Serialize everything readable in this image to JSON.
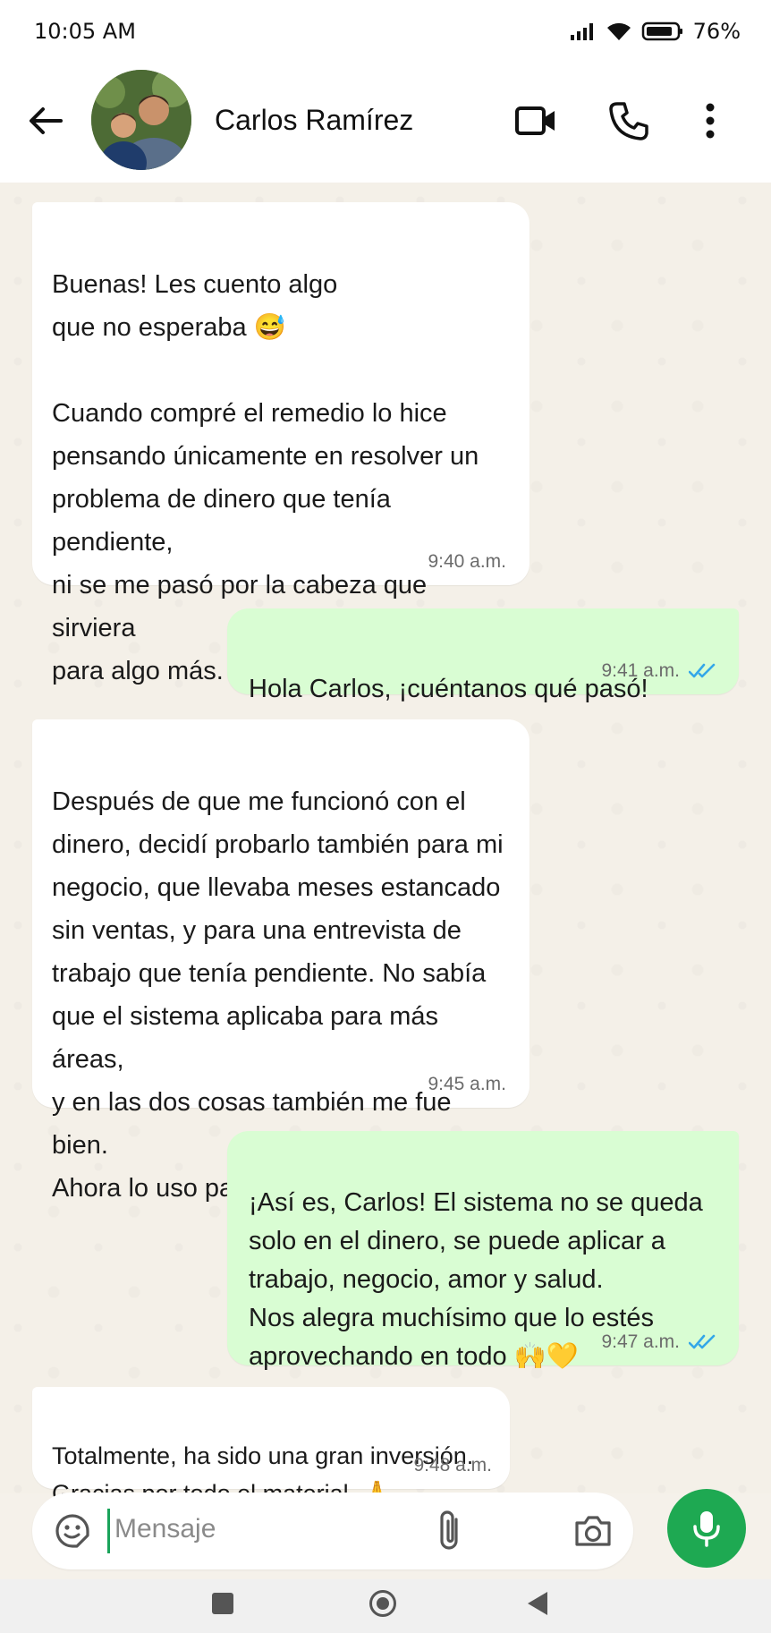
{
  "status_bar": {
    "time": "10:05 AM",
    "battery": "76%"
  },
  "header": {
    "contact_name": "Carlos Ramírez"
  },
  "messages": [
    {
      "direction": "in",
      "text": "Buenas! Les cuento algo\nque no esperaba 😅\n\nCuando compré el remedio lo hice\npensando únicamente en resolver un\nproblema de dinero que tenía pendiente,\nni se me pasó por la cabeza que sirviera\npara algo más.",
      "time": "9:40 a.m."
    },
    {
      "direction": "out",
      "text": "Hola Carlos, ¡cuéntanos qué pasó!",
      "time": "9:41 a.m.",
      "status": "read"
    },
    {
      "direction": "in",
      "text": "Después de que me funcionó con el\ndinero, decidí probarlo también para mi\nnegocio, que llevaba meses estancado\nsin ventas, y para una entrevista de\ntrabajo que tenía pendiente. No sabía\nque el sistema aplicaba para más áreas,\ny en las dos cosas también me fue bien.\nAhora lo uso para todo, la verdad.",
      "time": "9:45 a.m."
    },
    {
      "direction": "out",
      "text": "¡Así es, Carlos! El sistema no se queda\nsolo en el dinero, se puede aplicar a\ntrabajo, negocio, amor y salud.\nNos alegra muchísimo que lo estés\naprovechando en todo 🙌💛",
      "time": "9:47 a.m.",
      "status": "read"
    },
    {
      "direction": "in",
      "text": "Totalmente, ha sido una gran inversión.\nGracias por todo el material. 🙏",
      "time": "9:48 a.m."
    }
  ],
  "composer": {
    "placeholder": "Mensaje"
  },
  "colors": {
    "incoming": "#ffffff",
    "outgoing": "#d9fdd3",
    "accent": "#1ea952",
    "read_ticks": "#34a7e8",
    "chat_bg": "#f4f0e8"
  },
  "icons": [
    "back-arrow-icon",
    "video-call-icon",
    "phone-icon",
    "more-vertical-icon",
    "sticker-icon",
    "paperclip-icon",
    "camera-icon",
    "microphone-icon",
    "signal-icon",
    "wifi-icon",
    "battery-icon",
    "double-check-icon"
  ]
}
